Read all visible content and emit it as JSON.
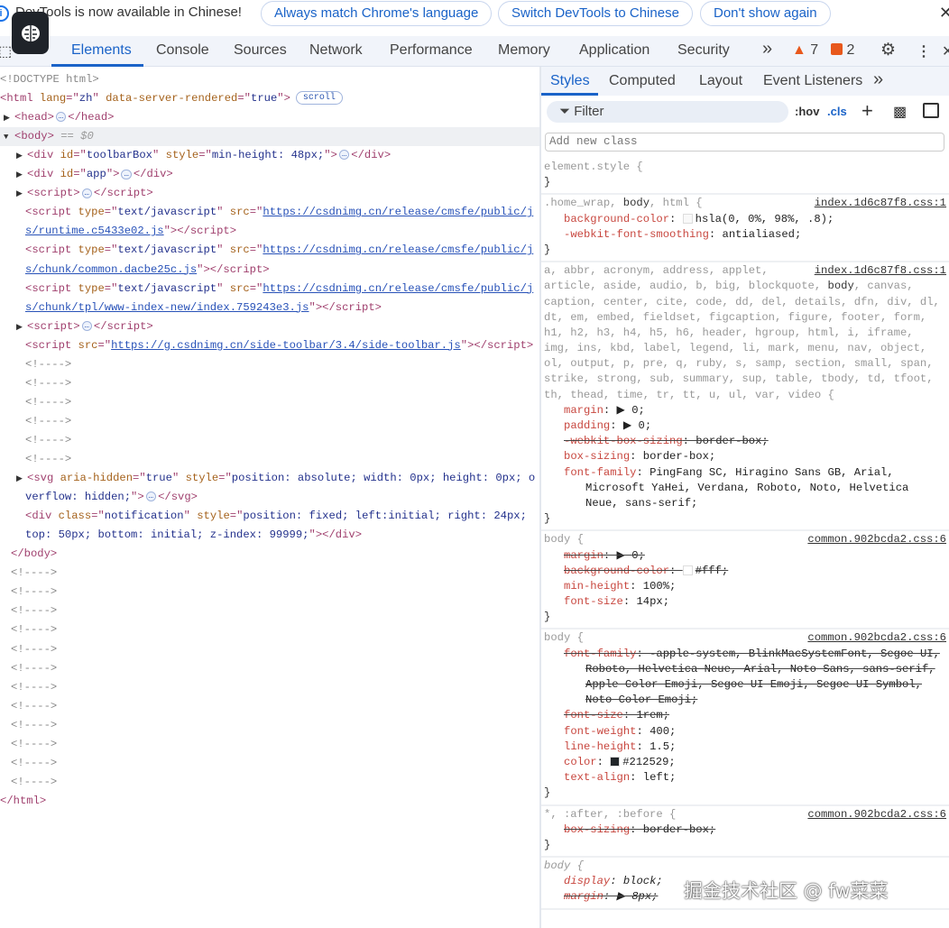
{
  "infobar": {
    "message": "DevTools is now available in Chinese!",
    "buttons": [
      "Always match Chrome's language",
      "Switch DevTools to Chinese",
      "Don't show again"
    ],
    "close": "✕"
  },
  "tabs": {
    "items": [
      "Elements",
      "Console",
      "Sources",
      "Network",
      "Performance",
      "Memory",
      "Application",
      "Security"
    ],
    "more": "»",
    "warnings": "7",
    "errors": "2"
  },
  "dom_lines": [
    {
      "d": 0,
      "s": [
        [
          "cm",
          "<!DOCTYPE html>"
        ]
      ]
    },
    {
      "d": 0,
      "s": [
        [
          "tag",
          "<html"
        ],
        [
          "",
          ""
        ],
        [
          "an",
          " lang"
        ],
        [
          "tag",
          "=\""
        ],
        [
          "av",
          "zh"
        ],
        [
          "tag",
          "\""
        ],
        [
          "an",
          " data-server-rendered"
        ],
        [
          "tag",
          "=\""
        ],
        [
          "av",
          "true"
        ],
        [
          "tag",
          "\">"
        ]
      ],
      "badge": "scroll"
    },
    {
      "d": 0,
      "t": "▶",
      "s": [
        [
          "tag",
          "<head>"
        ],
        [
          "dots",
          "…"
        ],
        [
          "tag",
          "</head>"
        ]
      ]
    },
    {
      "d": 0,
      "t": "▼",
      "sel": true,
      "s": [
        [
          "tag",
          "<body>"
        ],
        [
          "gr",
          " == $0"
        ]
      ]
    },
    {
      "d": 1,
      "t": "▶",
      "s": [
        [
          "tag",
          "<div"
        ],
        [
          "an",
          " id"
        ],
        [
          "tag",
          "=\""
        ],
        [
          "av",
          "toolbarBox"
        ],
        [
          "tag",
          "\""
        ],
        [
          "an",
          " style"
        ],
        [
          "tag",
          "=\""
        ],
        [
          "av",
          "min-height: 48px;"
        ],
        [
          "tag",
          "\">"
        ],
        [
          "dots",
          "…"
        ],
        [
          "tag",
          "</div>"
        ]
      ]
    },
    {
      "d": 1,
      "t": "▶",
      "s": [
        [
          "tag",
          "<div"
        ],
        [
          "an",
          " id"
        ],
        [
          "tag",
          "=\""
        ],
        [
          "av",
          "app"
        ],
        [
          "tag",
          "\">"
        ],
        [
          "dots",
          "…"
        ],
        [
          "tag",
          "</div>"
        ]
      ]
    },
    {
      "d": 1,
      "t": "▶",
      "s": [
        [
          "tag",
          "<script>"
        ],
        [
          "dots",
          "…"
        ],
        [
          "tag",
          "</script>"
        ]
      ]
    },
    {
      "d": 2,
      "s": [
        [
          "tag",
          "<script"
        ],
        [
          "an",
          " type"
        ],
        [
          "tag",
          "=\""
        ],
        [
          "av",
          "text/javascript"
        ],
        [
          "tag",
          "\""
        ],
        [
          "an",
          " src"
        ],
        [
          "tag",
          "=\""
        ],
        [
          "lk",
          "https://csdnimg.cn/release/cmsfe/public/j"
        ]
      ]
    },
    {
      "d": 2,
      "s": [
        [
          "lk",
          "s/runtime.c5433e02.js"
        ],
        [
          "tag",
          "\"></script>"
        ]
      ]
    },
    {
      "d": 2,
      "s": [
        [
          "tag",
          "<script"
        ],
        [
          "an",
          " type"
        ],
        [
          "tag",
          "=\""
        ],
        [
          "av",
          "text/javascript"
        ],
        [
          "tag",
          "\""
        ],
        [
          "an",
          " src"
        ],
        [
          "tag",
          "=\""
        ],
        [
          "lk",
          "https://csdnimg.cn/release/cmsfe/public/j"
        ]
      ]
    },
    {
      "d": 2,
      "s": [
        [
          "lk",
          "s/chunk/common.dacbe25c.js"
        ],
        [
          "tag",
          "\"></script>"
        ]
      ]
    },
    {
      "d": 2,
      "s": [
        [
          "tag",
          "<script"
        ],
        [
          "an",
          " type"
        ],
        [
          "tag",
          "=\""
        ],
        [
          "av",
          "text/javascript"
        ],
        [
          "tag",
          "\""
        ],
        [
          "an",
          " src"
        ],
        [
          "tag",
          "=\""
        ],
        [
          "lk",
          "https://csdnimg.cn/release/cmsfe/public/j"
        ]
      ]
    },
    {
      "d": 2,
      "s": [
        [
          "lk",
          "s/chunk/tpl/www-index-new/index.759243e3.js"
        ],
        [
          "tag",
          "\"></script>"
        ]
      ]
    },
    {
      "d": 1,
      "t": "▶",
      "s": [
        [
          "tag",
          "<script>"
        ],
        [
          "dots",
          "…"
        ],
        [
          "tag",
          "</script>"
        ]
      ]
    },
    {
      "d": 2,
      "s": [
        [
          "tag",
          "<script"
        ],
        [
          "an",
          " src"
        ],
        [
          "tag",
          "=\""
        ],
        [
          "lk",
          "https://g.csdnimg.cn/side-toolbar/3.4/side-toolbar.js"
        ],
        [
          "tag",
          "\"></script>"
        ]
      ]
    },
    {
      "d": 2,
      "s": [
        [
          "cm",
          "<!---->"
        ]
      ]
    },
    {
      "d": 2,
      "s": [
        [
          "cm",
          "<!---->"
        ]
      ]
    },
    {
      "d": 2,
      "s": [
        [
          "cm",
          "<!---->"
        ]
      ]
    },
    {
      "d": 2,
      "s": [
        [
          "cm",
          "<!---->"
        ]
      ]
    },
    {
      "d": 2,
      "s": [
        [
          "cm",
          "<!---->"
        ]
      ]
    },
    {
      "d": 2,
      "s": [
        [
          "cm",
          "<!---->"
        ]
      ]
    },
    {
      "d": 1,
      "t": "▶",
      "s": [
        [
          "tag",
          "<svg"
        ],
        [
          "an",
          " aria-hidden"
        ],
        [
          "tag",
          "=\""
        ],
        [
          "av",
          "true"
        ],
        [
          "tag",
          "\""
        ],
        [
          "an",
          " style"
        ],
        [
          "tag",
          "=\""
        ],
        [
          "av",
          "position: absolute; width: 0px; height: 0px; o"
        ]
      ]
    },
    {
      "d": 2,
      "s": [
        [
          "av",
          "verflow: hidden;"
        ],
        [
          "tag",
          "\">"
        ],
        [
          "dots",
          "…"
        ],
        [
          "tag",
          "</svg>"
        ]
      ]
    },
    {
      "d": 2,
      "s": [
        [
          "tag",
          "<div"
        ],
        [
          "an",
          " class"
        ],
        [
          "tag",
          "=\""
        ],
        [
          "av",
          "notification"
        ],
        [
          "tag",
          "\""
        ],
        [
          "an",
          " style"
        ],
        [
          "tag",
          "=\""
        ],
        [
          "av",
          "position: fixed; left:initial; right: 24px;"
        ]
      ]
    },
    {
      "d": 2,
      "s": [
        [
          "av",
          "top: 50px; bottom: initial; z-index: 99999;"
        ],
        [
          "tag",
          "\"></div>"
        ]
      ]
    },
    {
      "d": 3,
      "s": [
        [
          "tag",
          "</body>"
        ]
      ]
    },
    {
      "d": 3,
      "s": [
        [
          "cm",
          "<!---->"
        ]
      ]
    },
    {
      "d": 3,
      "s": [
        [
          "cm",
          "<!---->"
        ]
      ]
    },
    {
      "d": 3,
      "s": [
        [
          "cm",
          "<!---->"
        ]
      ]
    },
    {
      "d": 3,
      "s": [
        [
          "cm",
          "<!---->"
        ]
      ]
    },
    {
      "d": 3,
      "s": [
        [
          "cm",
          "<!---->"
        ]
      ]
    },
    {
      "d": 3,
      "s": [
        [
          "cm",
          "<!---->"
        ]
      ]
    },
    {
      "d": 3,
      "s": [
        [
          "cm",
          "<!---->"
        ]
      ]
    },
    {
      "d": 3,
      "s": [
        [
          "cm",
          "<!---->"
        ]
      ]
    },
    {
      "d": 3,
      "s": [
        [
          "cm",
          "<!---->"
        ]
      ]
    },
    {
      "d": 3,
      "s": [
        [
          "cm",
          "<!---->"
        ]
      ]
    },
    {
      "d": 3,
      "s": [
        [
          "cm",
          "<!---->"
        ]
      ]
    },
    {
      "d": 3,
      "s": [
        [
          "cm",
          "<!---->"
        ]
      ]
    },
    {
      "d": 0,
      "s": [
        [
          "tag",
          "</html>"
        ]
      ]
    }
  ],
  "sidebar": {
    "tabs": [
      "Styles",
      "Computed",
      "Layout",
      "Event Listeners"
    ],
    "more": "»",
    "filter_placeholder": "Filter",
    "hov": ":hov",
    "cls": ".cls",
    "add_class_placeholder": "Add new class"
  },
  "rules": [
    {
      "lines": [
        {
          "s": [
            [
              "sel1",
              "element.style {"
            ]
          ]
        },
        {
          "s": [
            [
              "selm",
              "}"
            ]
          ]
        }
      ]
    },
    {
      "src": "index.1d6c87f8.css:1",
      "lines": [
        {
          "s": [
            [
              "sel1",
              ".home_wrap, "
            ],
            [
              "selm",
              "body"
            ],
            [
              "sel1",
              ", html {"
            ]
          ]
        },
        {
          "i": 1,
          "s": [
            [
              "pn",
              "background-color"
            ],
            [
              "pv",
              ": "
            ],
            [
              "sw",
              "#f9f9f9"
            ],
            [
              "pv",
              "hsla(0, 0%, 98%, .8);"
            ]
          ]
        },
        {
          "i": 1,
          "s": [
            [
              "pn",
              "-webkit-font-smoothing"
            ],
            [
              "pv",
              ": antialiased;"
            ]
          ]
        },
        {
          "s": [
            [
              "selm",
              "}"
            ]
          ]
        }
      ]
    },
    {
      "src": "index.1d6c87f8.css:1",
      "lines": [
        {
          "s": [
            [
              "sel1",
              "a, abbr, acronym, address, applet,"
            ]
          ]
        },
        {
          "s": [
            [
              "sel1",
              "article, aside, audio, b, big, blockquote, "
            ],
            [
              "selm",
              "body"
            ],
            [
              "sel1",
              ", canvas,"
            ]
          ]
        },
        {
          "s": [
            [
              "sel1",
              "caption, center, cite, code, dd, del, details, dfn, div, dl,"
            ]
          ]
        },
        {
          "s": [
            [
              "sel1",
              "dt, em, embed, fieldset, figcaption, figure, footer, form,"
            ]
          ]
        },
        {
          "s": [
            [
              "sel1",
              "h1, h2, h3, h4, h5, h6, header, hgroup, html, i, iframe,"
            ]
          ]
        },
        {
          "s": [
            [
              "sel1",
              "img, ins, kbd, label, legend, li, mark, menu, nav, object,"
            ]
          ]
        },
        {
          "s": [
            [
              "sel1",
              "ol, output, p, pre, q, ruby, s, samp, section, small, span,"
            ]
          ]
        },
        {
          "s": [
            [
              "sel1",
              "strike, strong, sub, summary, sup, table, tbody, td, tfoot,"
            ]
          ]
        },
        {
          "s": [
            [
              "sel1",
              "th, thead, time, tr, tt, u, ul, var, video {"
            ]
          ]
        },
        {
          "i": 1,
          "s": [
            [
              "pn",
              "margin"
            ],
            [
              "pv",
              ": ▶ 0;"
            ]
          ]
        },
        {
          "i": 1,
          "s": [
            [
              "pn",
              "padding"
            ],
            [
              "pv",
              ": ▶ 0;"
            ]
          ]
        },
        {
          "i": 1,
          "x": true,
          "s": [
            [
              "pn",
              "-webkit-box-sizing"
            ],
            [
              "pv",
              ": border-box;"
            ]
          ]
        },
        {
          "i": 1,
          "s": [
            [
              "pn",
              "box-sizing"
            ],
            [
              "pv",
              ": border-box;"
            ]
          ]
        },
        {
          "i": 1,
          "s": [
            [
              "pn",
              "font-family"
            ],
            [
              "pv",
              ": PingFang SC, Hiragino Sans GB, Arial,"
            ]
          ]
        },
        {
          "i": 2,
          "s": [
            [
              "pv",
              "Microsoft YaHei, Verdana, Roboto, Noto, Helvetica"
            ]
          ]
        },
        {
          "i": 2,
          "s": [
            [
              "pv",
              "Neue, sans-serif;"
            ]
          ]
        },
        {
          "s": [
            [
              "selm",
              "}"
            ]
          ]
        }
      ]
    },
    {
      "src": "common.902bcda2.css:6",
      "lines": [
        {
          "s": [
            [
              "sel1",
              "body {"
            ]
          ]
        },
        {
          "i": 1,
          "x": true,
          "s": [
            [
              "pn",
              "margin"
            ],
            [
              "pv",
              ": ▶ 0;"
            ]
          ]
        },
        {
          "i": 1,
          "x": true,
          "s": [
            [
              "pn",
              "background-color"
            ],
            [
              "pv",
              ": "
            ],
            [
              "sw",
              "#ffffff"
            ],
            [
              "pv",
              "#fff;"
            ]
          ]
        },
        {
          "i": 1,
          "s": [
            [
              "pn",
              "min-height"
            ],
            [
              "pv",
              ": 100%;"
            ]
          ]
        },
        {
          "i": 1,
          "s": [
            [
              "pn",
              "font-size"
            ],
            [
              "pv",
              ": 14px;"
            ]
          ]
        },
        {
          "s": [
            [
              "selm",
              "}"
            ]
          ]
        }
      ]
    },
    {
      "src": "common.902bcda2.css:6",
      "lines": [
        {
          "s": [
            [
              "sel1",
              "body {"
            ]
          ]
        },
        {
          "i": 1,
          "x": true,
          "s": [
            [
              "pn",
              "font-family"
            ],
            [
              "pv",
              ": -apple-system, BlinkMacSystemFont, Segoe UI,"
            ]
          ]
        },
        {
          "i": 2,
          "x": true,
          "s": [
            [
              "pv",
              "Roboto, Helvetica Neue, Arial, Noto Sans, sans-serif,"
            ]
          ]
        },
        {
          "i": 2,
          "x": true,
          "s": [
            [
              "pv",
              "Apple Color Emoji, Segoe UI Emoji, Segoe UI Symbol,"
            ]
          ]
        },
        {
          "i": 2,
          "x": true,
          "s": [
            [
              "pv",
              "Noto Color Emoji;"
            ]
          ]
        },
        {
          "i": 1,
          "x": true,
          "s": [
            [
              "pn",
              "font-size"
            ],
            [
              "pv",
              ": 1rem;"
            ]
          ]
        },
        {
          "i": 1,
          "s": [
            [
              "pn",
              "font-weight"
            ],
            [
              "pv",
              ": 400;"
            ]
          ]
        },
        {
          "i": 1,
          "s": [
            [
              "pn",
              "line-height"
            ],
            [
              "pv",
              ": 1.5;"
            ]
          ]
        },
        {
          "i": 1,
          "s": [
            [
              "pn",
              "color"
            ],
            [
              "pv",
              ": "
            ],
            [
              "sw",
              "#212529"
            ],
            [
              "pv",
              "#212529;"
            ]
          ]
        },
        {
          "i": 1,
          "s": [
            [
              "pn",
              "text-align"
            ],
            [
              "pv",
              ": left;"
            ]
          ]
        },
        {
          "s": [
            [
              "selm",
              "}"
            ]
          ]
        }
      ]
    },
    {
      "src": "common.902bcda2.css:6",
      "lines": [
        {
          "s": [
            [
              "sel1",
              "*, :after, :before {"
            ]
          ]
        },
        {
          "i": 1,
          "x": true,
          "s": [
            [
              "pn",
              "box-sizing"
            ],
            [
              "pv",
              ": border-box;"
            ]
          ]
        },
        {
          "s": [
            [
              "selm",
              "}"
            ]
          ]
        }
      ]
    },
    {
      "italic": true,
      "lines": [
        {
          "s": [
            [
              "sel1",
              "body {"
            ]
          ]
        },
        {
          "i": 1,
          "s": [
            [
              "pn",
              "display"
            ],
            [
              "pv",
              ": block;"
            ]
          ]
        },
        {
          "i": 1,
          "x": true,
          "s": [
            [
              "pn",
              "margin"
            ],
            [
              "pv",
              ": ▶ 8px;"
            ]
          ]
        }
      ]
    }
  ],
  "watermark": "掘金技术社区 @ fw菜菜"
}
